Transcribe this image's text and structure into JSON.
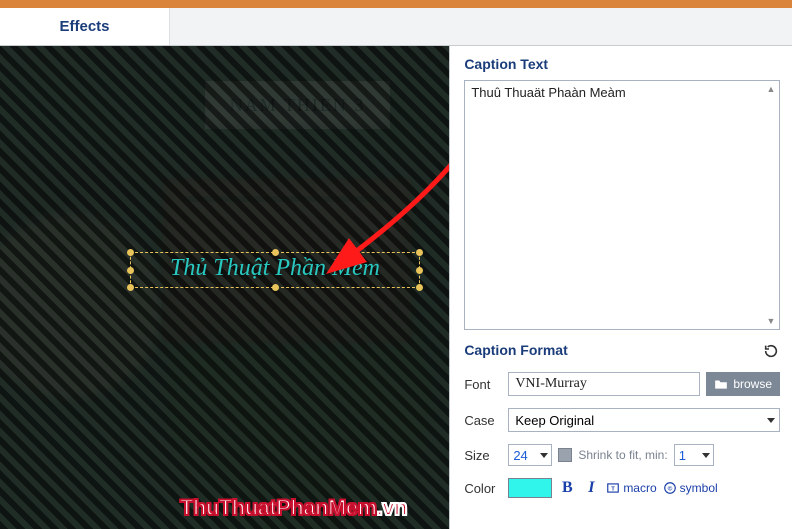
{
  "tabs": {
    "effects": "Effects"
  },
  "preview": {
    "sign_text": "NAM THIEN 3",
    "caption_rendered": "Thủ Thuật Phần Mềm",
    "watermark_main": "ThuThuatPhanMem",
    "watermark_suffix": ".vn"
  },
  "panel": {
    "caption_text_title": "Caption Text",
    "caption_text_value": "Thuû Thuaät Phaàn Meàm",
    "caption_format_title": "Caption Format",
    "font": {
      "label": "Font",
      "value": "VNI-Murray",
      "browse": "browse"
    },
    "case": {
      "label": "Case",
      "value": "Keep Original"
    },
    "size": {
      "label": "Size",
      "value": "24",
      "shrink_label": "Shrink to fit, min:",
      "min_value": "1"
    },
    "color": {
      "label": "Color",
      "swatch": "#2ff5ea",
      "bold": "B",
      "italic": "I",
      "macro": "macro",
      "symbol": "symbol"
    }
  }
}
